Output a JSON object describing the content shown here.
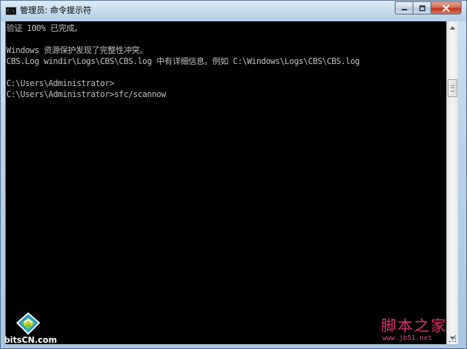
{
  "window": {
    "title": "管理员: 命令提示符",
    "icon_name": "cmd-console-icon",
    "icon_text": "C:\\",
    "buttons": {
      "minimize": "minimize-icon",
      "maximize": "maximize-icon",
      "close": "close-icon"
    }
  },
  "console": {
    "lines": [
      "验证 100% 已完成。",
      "",
      "Windows 资源保护发现了完整性冲突。",
      "CBS.Log windir\\Logs\\CBS\\CBS.log 中有详细信息。例如 C:\\Windows\\Logs\\CBS\\CBS.log",
      "",
      "C:\\Users\\Administrator>",
      "C:\\Users\\Administrator>sfc/scannow"
    ],
    "background": "#000000",
    "foreground": "#c0c0c0"
  },
  "watermarks": {
    "left": "bitsCN.com",
    "right_main": "脚本之家",
    "right_url": "www.jb51.net"
  },
  "colors": {
    "close_button": "#c2391b",
    "watermark_right": "#e0306a"
  }
}
